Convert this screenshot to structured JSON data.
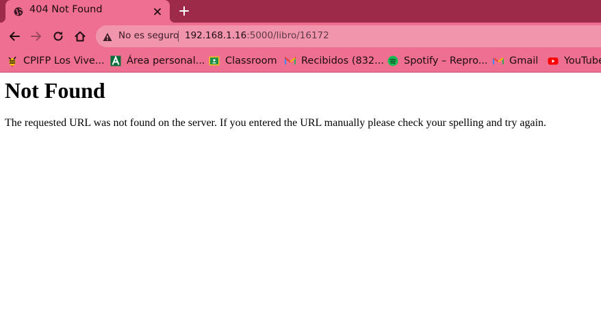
{
  "browser": {
    "tab": {
      "title": "404 Not Found",
      "favicon": "globe-icon"
    },
    "new_tab_icon": "plus-icon",
    "toolbar": {
      "back_icon": "arrow-left-icon",
      "forward_icon": "arrow-right-icon",
      "reload_icon": "reload-icon",
      "home_icon": "home-icon"
    },
    "omnibox": {
      "security_icon": "warning-triangle-icon",
      "security_text": "No es seguro",
      "url_host": "192.168.1.16",
      "url_rest": ":5000/libro/16172"
    },
    "bookmarks": [
      {
        "label": "CPIFP Los Vive...",
        "icon": "bee-icon"
      },
      {
        "label": "Área personal...",
        "icon": "andalucia-icon"
      },
      {
        "label": "Classroom",
        "icon": "classroom-icon"
      },
      {
        "label": "Recibidos (832...",
        "icon": "gmail-icon"
      },
      {
        "label": "Spotify – Repro...",
        "icon": "spotify-icon"
      },
      {
        "label": "Gmail",
        "icon": "gmail-icon"
      },
      {
        "label": "YouTube",
        "icon": "youtube-icon"
      }
    ]
  },
  "page": {
    "heading": "Not Found",
    "message": "The requested URL was not found on the server. If you entered the URL manually please check your spelling and try again."
  },
  "colors": {
    "tabstrip": "#9e2a4a",
    "toolbar": "#ee6f8f",
    "omnibox": "#f195ad",
    "page_background": "#ffffff"
  }
}
